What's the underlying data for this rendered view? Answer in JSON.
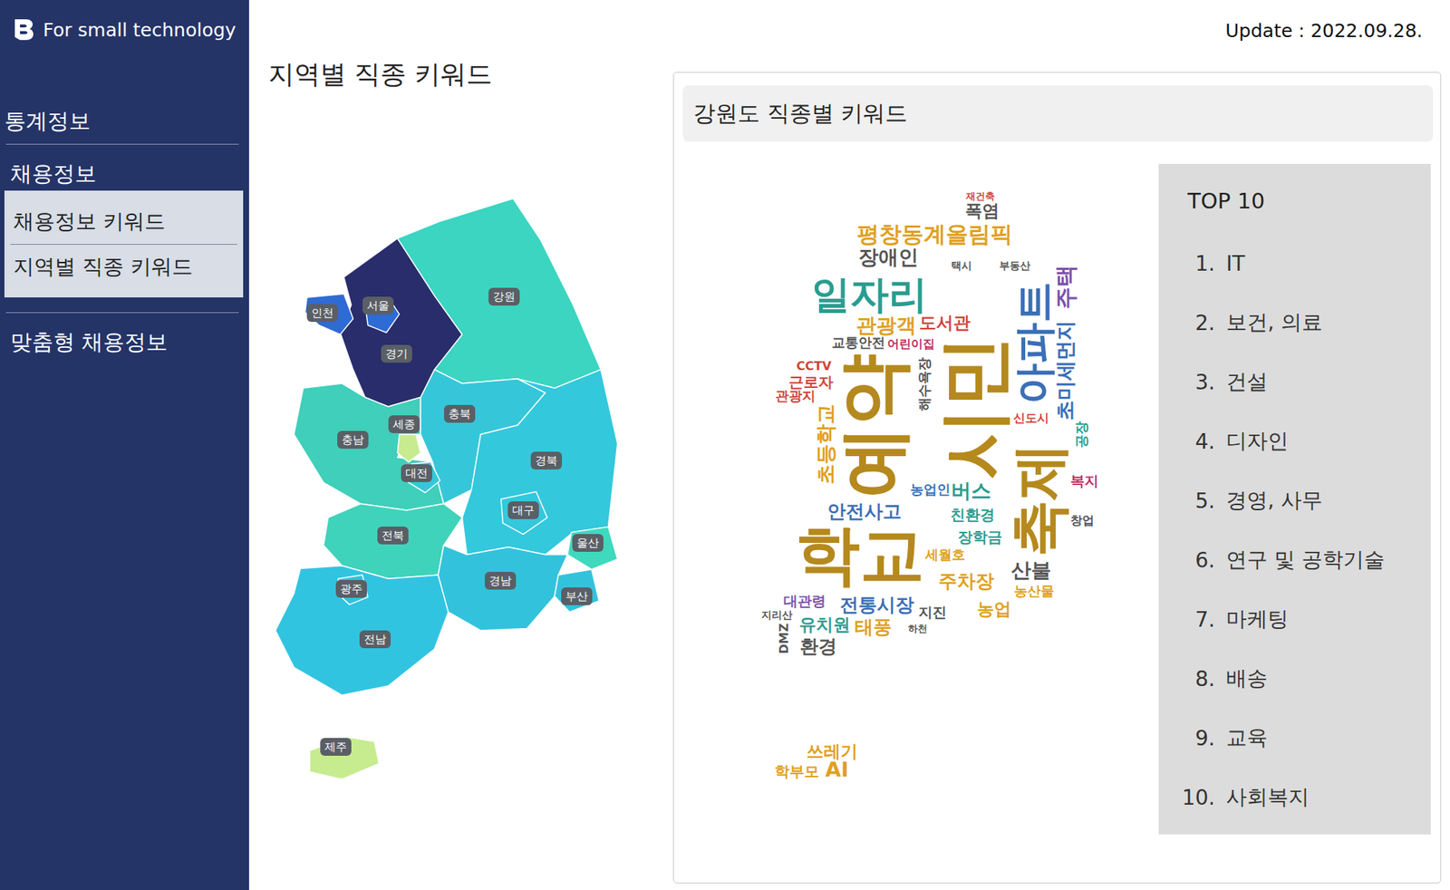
{
  "sidebar": {
    "logo": "For small technology",
    "sections": [
      {
        "label": "통계정보",
        "expanded": false,
        "children": []
      },
      {
        "label": "채용정보",
        "expanded": true,
        "children": [
          {
            "label": "채용정보 키워드"
          },
          {
            "label": "지역별 직종 키워드"
          }
        ]
      },
      {
        "label": "맞춤형 채용정보",
        "expanded": false,
        "children": []
      }
    ]
  },
  "page": {
    "title": "지역별 직종 키워드",
    "update": "Update : 2022.09.28."
  },
  "map": {
    "regions": [
      {
        "name": "서울",
        "color": "#2e6bd4"
      },
      {
        "name": "인천",
        "color": "#2e6bd4"
      },
      {
        "name": "경기",
        "color": "#292d6b"
      },
      {
        "name": "강원",
        "color": "#3bd5c1"
      },
      {
        "name": "충북",
        "color": "#35c7d9"
      },
      {
        "name": "세종",
        "color": "#c6ec8f"
      },
      {
        "name": "충남",
        "color": "#3fcfba"
      },
      {
        "name": "대전",
        "color": "#35c7d9"
      },
      {
        "name": "경북",
        "color": "#33c8dc"
      },
      {
        "name": "대구",
        "color": "#33c8dc"
      },
      {
        "name": "전북",
        "color": "#40d3bb"
      },
      {
        "name": "울산",
        "color": "#3fd9bd"
      },
      {
        "name": "경남",
        "color": "#33c2dc"
      },
      {
        "name": "부산",
        "color": "#33c2dc"
      },
      {
        "name": "광주",
        "color": "#33c2dc"
      },
      {
        "name": "전남",
        "color": "#31c4e1"
      },
      {
        "name": "제주",
        "color": "#c6ec8f"
      }
    ]
  },
  "panel": {
    "title": "강원도 직종별 키워드",
    "cloud": {
      "words": [
        {
          "text": "학교",
          "color": "#b5891e"
        },
        {
          "text": "시민",
          "color": "#b5891e"
        },
        {
          "text": "예약",
          "color": "#b5891e"
        },
        {
          "text": "축제",
          "color": "#b5891e"
        },
        {
          "text": "일자리",
          "color": "#2a9d8f"
        },
        {
          "text": "아파트",
          "color": "#3b6fb6"
        },
        {
          "text": "평창동계올림픽",
          "color": "#e0a020"
        },
        {
          "text": "장애인",
          "color": "#555555"
        },
        {
          "text": "주택",
          "color": "#7b52ab"
        },
        {
          "text": "관광객",
          "color": "#e0a020"
        },
        {
          "text": "도서관",
          "color": "#d0453a"
        },
        {
          "text": "어린이집",
          "color": "#c03060"
        },
        {
          "text": "초미세먼지",
          "color": "#3b6fb6"
        },
        {
          "text": "초등학교",
          "color": "#e0a020"
        },
        {
          "text": "근로자",
          "color": "#d0453a"
        },
        {
          "text": "CCTV",
          "color": "#d0453a"
        },
        {
          "text": "관광지",
          "color": "#d0453a"
        },
        {
          "text": "교통안전",
          "color": "#555555"
        },
        {
          "text": "버스",
          "color": "#2a9d8f"
        },
        {
          "text": "안전사고",
          "color": "#3b6fb6"
        },
        {
          "text": "친환경",
          "color": "#2a9d8f"
        },
        {
          "text": "장학금",
          "color": "#2a9d8f"
        },
        {
          "text": "산불",
          "color": "#555555"
        },
        {
          "text": "주차장",
          "color": "#e0a020"
        },
        {
          "text": "농산물",
          "color": "#e0a020"
        },
        {
          "text": "전통시장",
          "color": "#3b6fb6"
        },
        {
          "text": "대관령",
          "color": "#7b52ab"
        },
        {
          "text": "유치원",
          "color": "#2a9d8f"
        },
        {
          "text": "태풍",
          "color": "#e0a020"
        },
        {
          "text": "환경",
          "color": "#555555"
        },
        {
          "text": "농업",
          "color": "#e0a020"
        },
        {
          "text": "지진",
          "color": "#555555"
        },
        {
          "text": "세월호",
          "color": "#e0a020"
        },
        {
          "text": "폭염",
          "color": "#555555"
        },
        {
          "text": "재건축",
          "color": "#d0453a"
        },
        {
          "text": "신도시",
          "color": "#d0453a"
        },
        {
          "text": "농업인",
          "color": "#3b6fb6"
        },
        {
          "text": "복지",
          "color": "#c03060"
        },
        {
          "text": "공장",
          "color": "#2a9d8f"
        },
        {
          "text": "쓰레기",
          "color": "#e0a020"
        },
        {
          "text": "학부모",
          "color": "#e0a020"
        },
        {
          "text": "AI",
          "color": "#e0a020"
        },
        {
          "text": "창업",
          "color": "#555555"
        },
        {
          "text": "부동산",
          "color": "#555555"
        },
        {
          "text": "택시",
          "color": "#555555"
        },
        {
          "text": "해수욕장",
          "color": "#555555"
        },
        {
          "text": "DMZ",
          "color": "#555555"
        },
        {
          "text": "지리산",
          "color": "#555555"
        },
        {
          "text": "하천",
          "color": "#555555"
        }
      ]
    },
    "top": {
      "title": "TOP 10",
      "items": [
        {
          "rank": "1.",
          "label": "IT"
        },
        {
          "rank": "2.",
          "label": "보건, 의료"
        },
        {
          "rank": "3.",
          "label": "건설"
        },
        {
          "rank": "4.",
          "label": "디자인"
        },
        {
          "rank": "5.",
          "label": "경영, 사무"
        },
        {
          "rank": "6.",
          "label": "연구 및 공학기술"
        },
        {
          "rank": "7.",
          "label": "마케팅"
        },
        {
          "rank": "8.",
          "label": "배송"
        },
        {
          "rank": "9.",
          "label": "교육"
        },
        {
          "rank": "10.",
          "label": "사회복지"
        }
      ]
    }
  }
}
